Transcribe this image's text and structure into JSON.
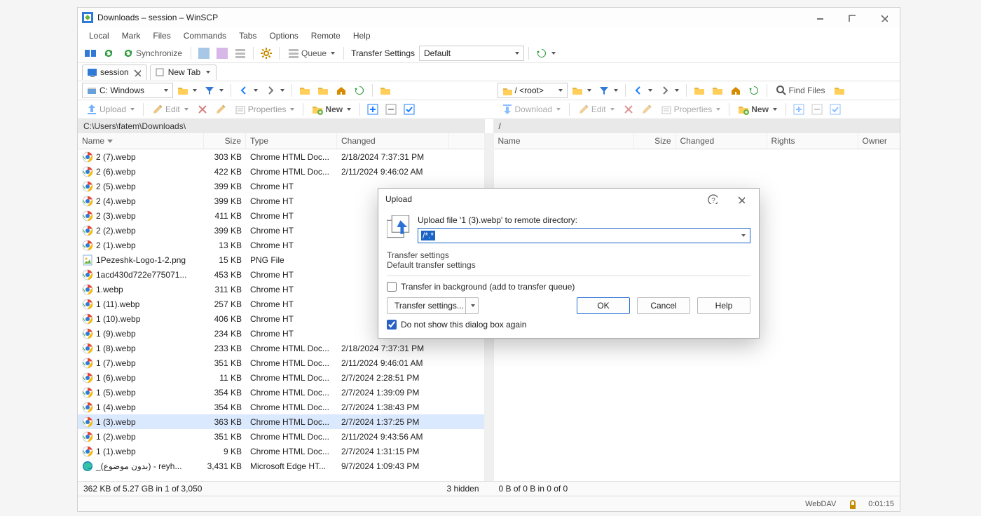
{
  "title": "Downloads – session – WinSCP",
  "menu": [
    "Local",
    "Mark",
    "Files",
    "Commands",
    "Tabs",
    "Options",
    "Remote",
    "Help"
  ],
  "toolbar1": {
    "sync_label": "Synchronize",
    "queue_label": "Queue",
    "transfer_settings_label": "Transfer Settings",
    "transfer_settings_value": "Default"
  },
  "session_tabs": {
    "tab1_label": "session",
    "tab2_label": "New Tab"
  },
  "local_nav": {
    "drive_label": "C: Windows"
  },
  "remote_nav": {
    "drive_label": "/ <root>",
    "find_label": "Find Files"
  },
  "local_cmd": {
    "upload": "Upload",
    "edit": "Edit",
    "properties": "Properties",
    "new": "New"
  },
  "remote_cmd": {
    "download": "Download",
    "edit": "Edit",
    "properties": "Properties",
    "new": "New"
  },
  "local_path": "C:\\Users\\fatem\\Downloads\\",
  "remote_path": "/",
  "local_headers": {
    "name": "Name",
    "size": "Size",
    "type": "Type",
    "changed": "Changed"
  },
  "remote_headers": {
    "name": "Name",
    "size": "Size",
    "changed": "Changed",
    "rights": "Rights",
    "owner": "Owner"
  },
  "files_local": [
    {
      "icon": "chrome",
      "name": "2 (7).webp",
      "size": "303 KB",
      "type": "Chrome HTML Doc...",
      "changed": "2/18/2024 7:37:31 PM"
    },
    {
      "icon": "chrome",
      "name": "2 (6).webp",
      "size": "422 KB",
      "type": "Chrome HTML Doc...",
      "changed": "2/11/2024 9:46:02 AM"
    },
    {
      "icon": "chrome",
      "name": "2 (5).webp",
      "size": "399 KB",
      "type": "Chrome HT",
      "changed": ""
    },
    {
      "icon": "chrome",
      "name": "2 (4).webp",
      "size": "399 KB",
      "type": "Chrome HT",
      "changed": ""
    },
    {
      "icon": "chrome",
      "name": "2 (3).webp",
      "size": "411 KB",
      "type": "Chrome HT",
      "changed": ""
    },
    {
      "icon": "chrome",
      "name": "2 (2).webp",
      "size": "399 KB",
      "type": "Chrome HT",
      "changed": ""
    },
    {
      "icon": "chrome",
      "name": "2 (1).webp",
      "size": "13 KB",
      "type": "Chrome HT",
      "changed": ""
    },
    {
      "icon": "png",
      "name": "1Pezeshk-Logo-1-2.png",
      "size": "15 KB",
      "type": "PNG File",
      "changed": ""
    },
    {
      "icon": "chrome",
      "name": "1acd430d722e775071...",
      "size": "453 KB",
      "type": "Chrome HT",
      "changed": ""
    },
    {
      "icon": "chrome",
      "name": "1.webp",
      "size": "311 KB",
      "type": "Chrome HT",
      "changed": ""
    },
    {
      "icon": "chrome",
      "name": "1 (11).webp",
      "size": "257 KB",
      "type": "Chrome HT",
      "changed": ""
    },
    {
      "icon": "chrome",
      "name": "1 (10).webp",
      "size": "406 KB",
      "type": "Chrome HT",
      "changed": ""
    },
    {
      "icon": "chrome",
      "name": "1 (9).webp",
      "size": "234 KB",
      "type": "Chrome HT",
      "changed": ""
    },
    {
      "icon": "chrome",
      "name": "1 (8).webp",
      "size": "233 KB",
      "type": "Chrome HTML Doc...",
      "changed": "2/18/2024 7:37:31 PM"
    },
    {
      "icon": "chrome",
      "name": "1 (7).webp",
      "size": "351 KB",
      "type": "Chrome HTML Doc...",
      "changed": "2/11/2024 9:46:01 AM"
    },
    {
      "icon": "chrome",
      "name": "1 (6).webp",
      "size": "11 KB",
      "type": "Chrome HTML Doc...",
      "changed": "2/7/2024 2:28:51 PM"
    },
    {
      "icon": "chrome",
      "name": "1 (5).webp",
      "size": "354 KB",
      "type": "Chrome HTML Doc...",
      "changed": "2/7/2024 1:39:09 PM"
    },
    {
      "icon": "chrome",
      "name": "1 (4).webp",
      "size": "354 KB",
      "type": "Chrome HTML Doc...",
      "changed": "2/7/2024 1:38:43 PM"
    },
    {
      "icon": "chrome",
      "name": "1 (3).webp",
      "size": "363 KB",
      "type": "Chrome HTML Doc...",
      "changed": "2/7/2024 1:37:25 PM",
      "selected": true
    },
    {
      "icon": "chrome",
      "name": "1 (2).webp",
      "size": "351 KB",
      "type": "Chrome HTML Doc...",
      "changed": "2/11/2024 9:43:56 AM"
    },
    {
      "icon": "chrome",
      "name": "1 (1).webp",
      "size": "9 KB",
      "type": "Chrome HTML Doc...",
      "changed": "2/7/2024 1:31:15 PM"
    },
    {
      "icon": "edge",
      "name": "_(بدون موضوع) - reyh...",
      "size": "3,431 KB",
      "type": "Microsoft Edge HT...",
      "changed": "9/7/2024 1:09:43 PM"
    }
  ],
  "status_local": {
    "left": "362 KB of 5.27 GB in 1 of 3,050",
    "right": "3 hidden"
  },
  "status_remote": {
    "left": "0 B of 0 B in 0 of 0",
    "right": ""
  },
  "bottom": {
    "protocol": "WebDAV",
    "time": "0:01:15"
  },
  "dialog": {
    "title": "Upload",
    "prompt": "Upload file '1 (3).webp' to remote directory:",
    "path_selected": "/*.*",
    "settings_hdr": "Transfer settings",
    "settings_val": "Default transfer settings",
    "bg_label": "Transfer in background (add to transfer queue)",
    "bg_checked": false,
    "ts_btn": "Transfer settings...",
    "ok": "OK",
    "cancel": "Cancel",
    "help": "Help",
    "dontshow": "Do not show this dialog box again",
    "dontshow_checked": true
  }
}
